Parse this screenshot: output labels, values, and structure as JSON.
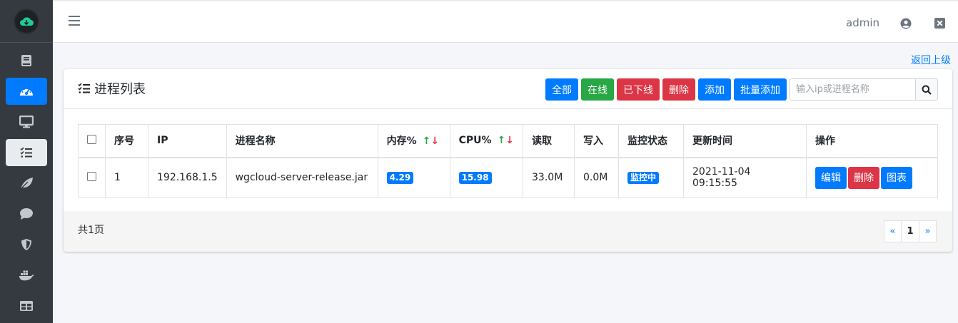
{
  "topbar": {
    "user": "admin"
  },
  "sidebar": {
    "items": [
      {
        "icon": "book-icon"
      },
      {
        "icon": "dashboard-icon",
        "active": true
      },
      {
        "icon": "desktop-icon"
      },
      {
        "icon": "tasks-icon",
        "current": true
      },
      {
        "icon": "leaf-icon"
      },
      {
        "icon": "comment-icon"
      },
      {
        "icon": "shield-icon"
      },
      {
        "icon": "docker-icon"
      },
      {
        "icon": "table-icon"
      }
    ]
  },
  "back_link": "返回上级",
  "card": {
    "title": "进程列表",
    "buttons": {
      "all": "全部",
      "online": "在线",
      "offline": "已下线",
      "delete": "删除",
      "add": "添加",
      "batch_add": "批量添加"
    },
    "search": {
      "placeholder": "输入ip或进程名称"
    }
  },
  "table": {
    "headers": {
      "index": "序号",
      "ip": "IP",
      "name": "进程名称",
      "memory": "内存%",
      "cpu": "CPU%",
      "read": "读取",
      "write": "写入",
      "status": "监控状态",
      "updated": "更新时间",
      "actions": "操作"
    },
    "sort_arrows": {
      "up": "↑",
      "down": "↓"
    },
    "rows": [
      {
        "index": "1",
        "ip": "192.168.1.5",
        "name": "wgcloud-server-release.jar",
        "memory": "4.29",
        "cpu": "15.98",
        "read": "33.0M",
        "write": "0.0M",
        "status": "监控中",
        "updated": "2021-11-04 09:15:55",
        "actions": {
          "edit": "编辑",
          "delete": "删除",
          "chart": "图表"
        }
      }
    ]
  },
  "footer": {
    "pages_text": "共1页",
    "pager": {
      "prev": "«",
      "current": "1",
      "next": "»"
    }
  },
  "colors": {
    "primary": "#007bff",
    "success": "#28a745",
    "danger": "#dc3545",
    "sidebar": "#343a40"
  }
}
